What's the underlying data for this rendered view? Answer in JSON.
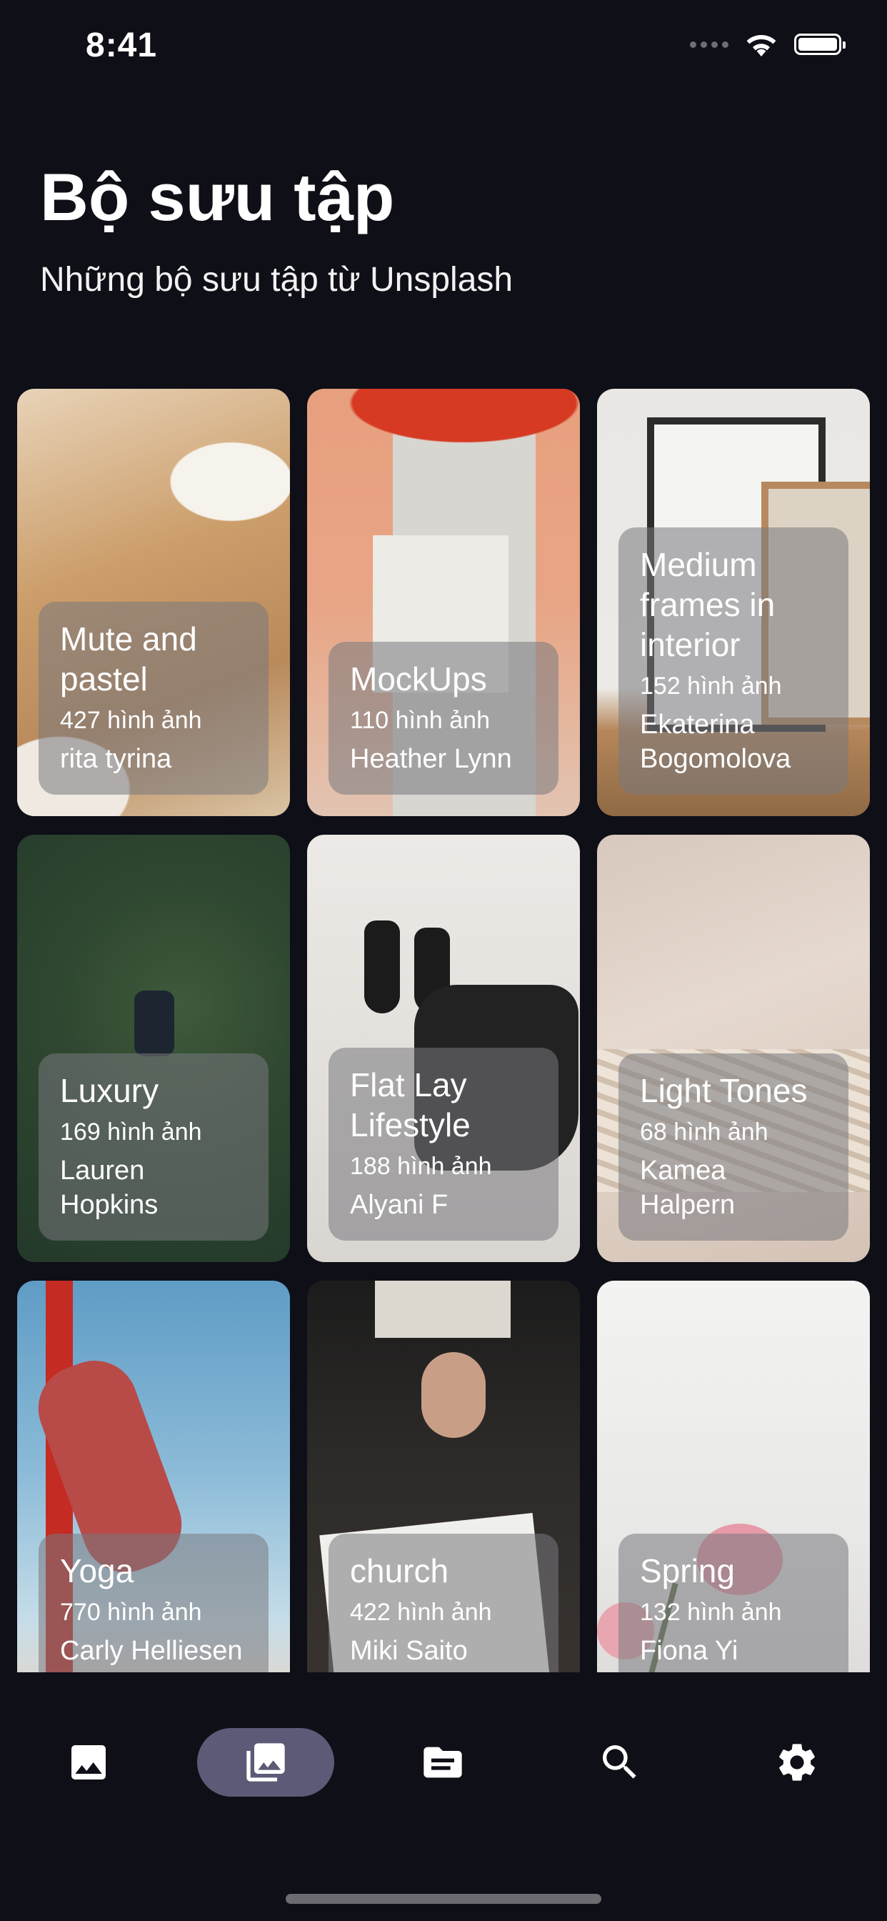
{
  "status_bar": {
    "time": "8:41"
  },
  "header": {
    "title": "Bộ sưu tập",
    "subtitle": "Những bộ sưu tập từ Unsplash"
  },
  "collections": [
    {
      "title": "Mute and pastel",
      "count": "427 hình ảnh",
      "author": "rita tyrina"
    },
    {
      "title": "MockUps",
      "count": "110 hình ảnh",
      "author": "Heather Lynn"
    },
    {
      "title": "Medium frames in interior",
      "count": "152 hình ảnh",
      "author": "Ekaterina Bogomolova"
    },
    {
      "title": "Luxury",
      "count": "169 hình ảnh",
      "author": "Lauren Hopkins"
    },
    {
      "title": "Flat Lay Lifestyle",
      "count": "188 hình ảnh",
      "author": "Alyani F"
    },
    {
      "title": "Light Tones",
      "count": "68 hình ảnh",
      "author": "Kamea Halpern"
    },
    {
      "title": "Yoga",
      "count": "770 hình ảnh",
      "author": "Carly Helliesen"
    },
    {
      "title": "church",
      "count": "422 hình ảnh",
      "author": "Miki Saito"
    },
    {
      "title": "Spring",
      "count": "132 hình ảnh",
      "author": "Fiona Yi"
    }
  ],
  "bottom_nav": {
    "items": [
      {
        "icon": "photo-icon",
        "active": false
      },
      {
        "icon": "collections-icon",
        "active": true
      },
      {
        "icon": "article-icon",
        "active": false
      },
      {
        "icon": "search-icon",
        "active": false
      },
      {
        "icon": "settings-icon",
        "active": false
      }
    ],
    "active_color": "#5c5b77"
  },
  "colors": {
    "background": "#0f0f17",
    "text": "#ffffff"
  }
}
